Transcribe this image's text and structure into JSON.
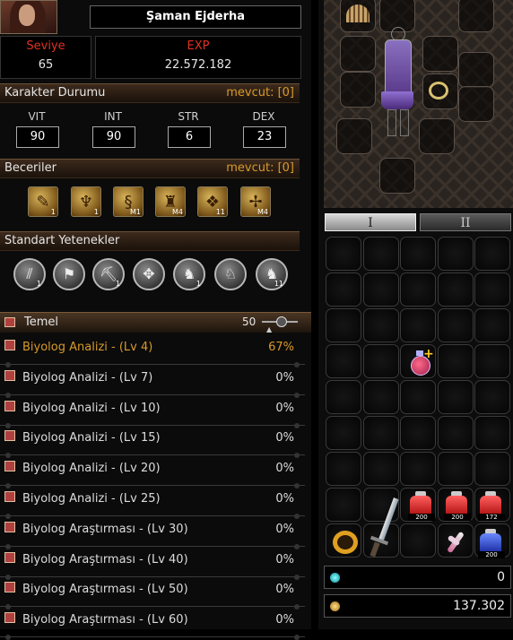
{
  "character": {
    "name": "Şaman Ejderha",
    "level_label": "Seviye",
    "level": "65",
    "exp_label": "EXP",
    "exp": "22.572.182"
  },
  "status_section": {
    "title": "Karakter Durumu",
    "available": "mevcut: [0]",
    "stats": [
      {
        "label": "VIT",
        "value": "90"
      },
      {
        "label": "INT",
        "value": "90"
      },
      {
        "label": "STR",
        "value": "6"
      },
      {
        "label": "DEX",
        "value": "23"
      }
    ]
  },
  "skills_section": {
    "title": "Beceriler",
    "available": "mevcut: [0]",
    "skills": [
      {
        "icon": "scroll-skill-icon",
        "glyph": "✎",
        "level": "1"
      },
      {
        "icon": "dragon-skill-icon",
        "glyph": "🐉",
        "level": "1"
      },
      {
        "icon": "serpent-skill-icon",
        "glyph": "§",
        "level": "M1"
      },
      {
        "icon": "bell-skill-icon",
        "glyph": "♜",
        "level": "M4"
      },
      {
        "icon": "totem-skill-icon",
        "glyph": "❖",
        "level": "11"
      },
      {
        "icon": "pinwheel-skill-icon",
        "glyph": "✢",
        "level": "M4"
      }
    ]
  },
  "standard_section": {
    "title": "Standart Yetenekler",
    "skills": [
      {
        "icon": "claw-skill-icon",
        "glyph": "⫽",
        "level": "1"
      },
      {
        "icon": "flag-skill-icon",
        "glyph": "⚑",
        "level": ""
      },
      {
        "icon": "pickaxe-skill-icon",
        "glyph": "⛏",
        "level": "1"
      },
      {
        "icon": "knot-skill-icon",
        "glyph": "✥",
        "level": ""
      },
      {
        "icon": "horse-pot-skill-icon",
        "glyph": "♞",
        "level": "1"
      },
      {
        "icon": "horse-gallop-skill-icon",
        "glyph": "♘",
        "level": ""
      },
      {
        "icon": "horse-head-skill-icon",
        "glyph": "♞",
        "level": "11"
      }
    ]
  },
  "quests": {
    "header_title": "Temel",
    "header_count": "50",
    "rows": [
      {
        "name": "Biyolog Analizi - (Lv 4)",
        "pct": "67%",
        "active": true
      },
      {
        "name": "Biyolog Analizi - (Lv 7)",
        "pct": "0%"
      },
      {
        "name": "Biyolog Analizi - (Lv 10)",
        "pct": "0%"
      },
      {
        "name": "Biyolog Analizi - (Lv 15)",
        "pct": "0%"
      },
      {
        "name": "Biyolog Analizi - (Lv 20)",
        "pct": "0%"
      },
      {
        "name": "Biyolog Analizi - (Lv 25)",
        "pct": "0%"
      },
      {
        "name": "Biyolog Araştırması - (Lv 30)",
        "pct": "0%"
      },
      {
        "name": "Biyolog Araştırması - (Lv 40)",
        "pct": "0%"
      },
      {
        "name": "Biyolog Araştırması - (Lv 50)",
        "pct": "0%"
      },
      {
        "name": "Biyolog Araştırması - (Lv 60)",
        "pct": "0%"
      }
    ]
  },
  "inventory": {
    "tabs": [
      "I",
      "II"
    ],
    "potion_counts": [
      "200",
      "200",
      "172",
      "200"
    ],
    "gems": "0",
    "gold": "137.302"
  },
  "colors": {
    "accent": "#d89a2a",
    "red_label": "#e03020"
  }
}
